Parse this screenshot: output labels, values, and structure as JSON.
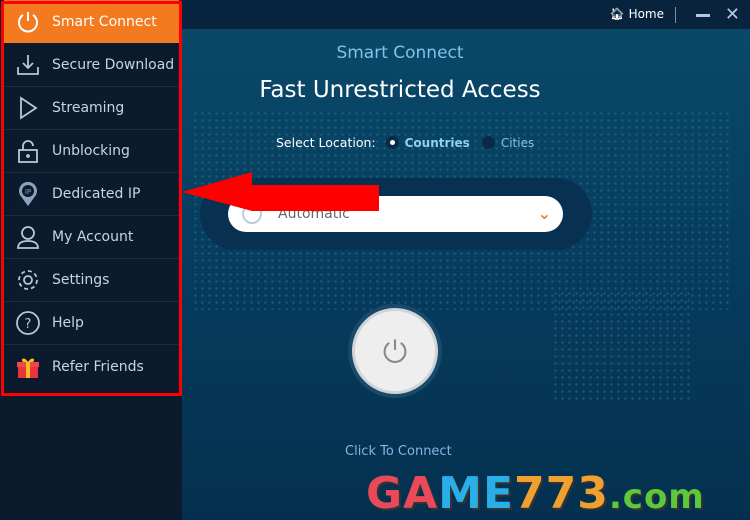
{
  "sidebar": {
    "items": [
      {
        "label": "Smart Connect",
        "icon": "power-icon",
        "active": true
      },
      {
        "label": "Secure Download",
        "icon": "download-icon"
      },
      {
        "label": "Streaming",
        "icon": "play-icon"
      },
      {
        "label": "Unblocking",
        "icon": "lock-icon"
      },
      {
        "label": "Dedicated IP",
        "icon": "ip-pin-icon"
      },
      {
        "label": "My Account",
        "icon": "user-icon"
      },
      {
        "label": "Settings",
        "icon": "gear-icon"
      },
      {
        "label": "Help",
        "icon": "help-icon"
      },
      {
        "label": "Refer Friends",
        "icon": "gift-icon"
      }
    ]
  },
  "topbar": {
    "home_label": "Home"
  },
  "main": {
    "subtitle": "Smart Connect",
    "title": "Fast Unrestricted Access",
    "select_location_label": "Select Location:",
    "options": [
      "Countries",
      "Cities"
    ],
    "selected_option": "Countries",
    "dropdown_value": "Automatic",
    "connect_label": "Click To Connect"
  },
  "watermark": {
    "text": "GAME773.com"
  },
  "colors": {
    "accent": "#f47a20",
    "annotation": "#ff0000"
  }
}
